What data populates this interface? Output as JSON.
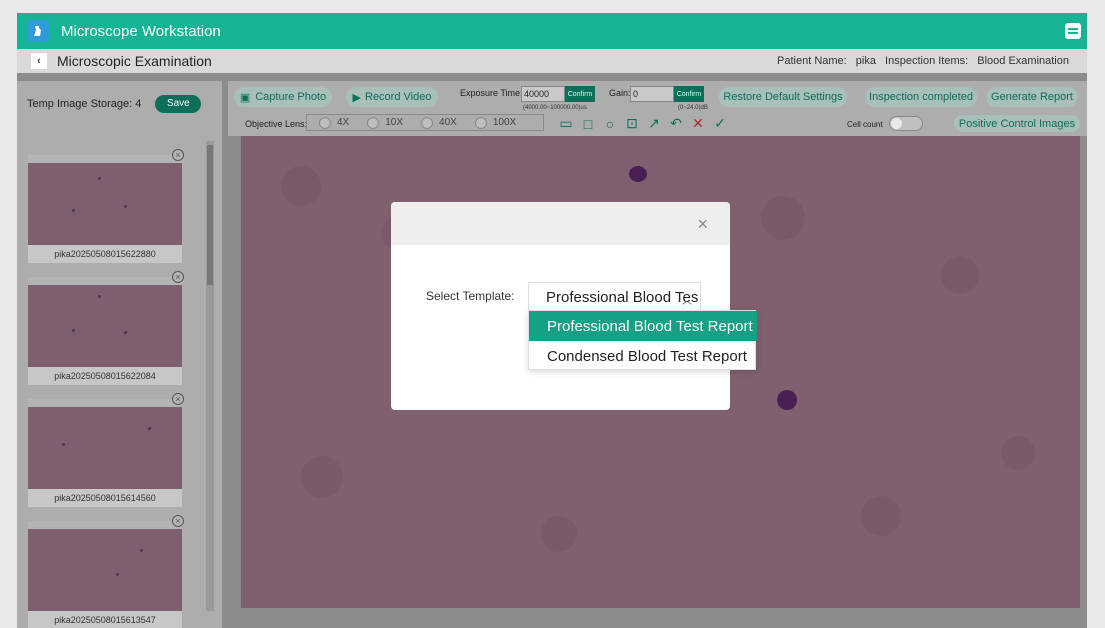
{
  "window": {
    "title": "Microscope Workstation"
  },
  "subheader": {
    "title": "Microscopic Examination",
    "patient_label": "Patient Name:",
    "patient_value": "pika",
    "items_label": "Inspection Items:",
    "items_value": "Blood Examination"
  },
  "storage": {
    "label": "Temp Image Storage: 4",
    "save_label": "Save"
  },
  "thumbnails": [
    {
      "name": "pika20250508015622880"
    },
    {
      "name": "pika20250508015622084"
    },
    {
      "name": "pika20250508015614560"
    },
    {
      "name": "pika20250508015613547"
    }
  ],
  "toolbar": {
    "capture_label": "Capture Photo",
    "record_label": "Record Video",
    "exposure_label": "Exposure Time:",
    "exposure_value": "40000",
    "exposure_confirm": "Confirm",
    "exposure_hint": "(4000.00~100000.00)us",
    "gain_label": "Gain:",
    "gain_value": "0",
    "gain_confirm": "Confirm",
    "gain_hint": "(0~24.0)dB",
    "restore_label": "Restore Default Settings",
    "inspection_label": "Inspection completed",
    "report_label": "Generate Report",
    "objective_label": "Objective Lens:",
    "lenses": [
      "4X",
      "10X",
      "40X",
      "100X"
    ],
    "cell_count_label": "Cell count",
    "positive_label": "Positive Control Images"
  },
  "modal": {
    "close_glyph": "×",
    "select_label": "Select Template:",
    "selected_value": "Professional Blood Tes",
    "options": [
      "Professional Blood Test Report",
      "Condensed Blood Test Report"
    ]
  },
  "colors": {
    "accent": "#16b494",
    "dark_accent": "#0d6e5a",
    "dropdown_active": "#16a085"
  }
}
